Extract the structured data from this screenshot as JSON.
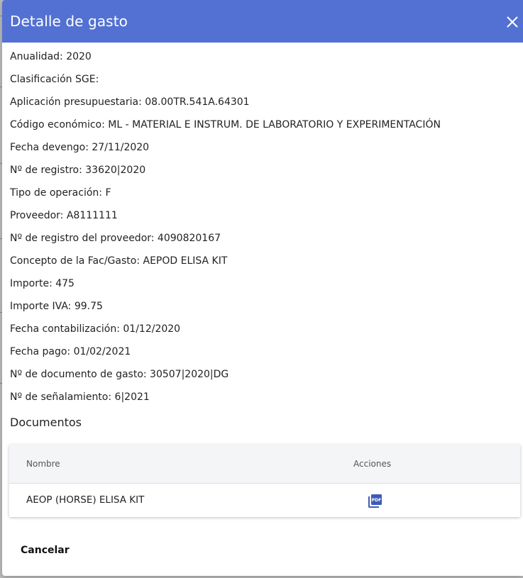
{
  "dialog": {
    "title": "Detalle de gasto"
  },
  "fields": [
    {
      "text": "Anualidad: 2020"
    },
    {
      "text": "Clasificación SGE:"
    },
    {
      "text": "Aplicación presupuestaria: 08.00TR.541A.64301"
    },
    {
      "text": "Código económico: ML - MATERIAL E INSTRUM. DE LABORATORIO Y EXPERIMENTACIÓN"
    },
    {
      "text": "Fecha devengo: 27/11/2020"
    },
    {
      "text": "Nº de registro: 33620|2020"
    },
    {
      "text": "Tipo de operación: F"
    },
    {
      "text": "Proveedor: A8111111"
    },
    {
      "text": "Nº de registro del proveedor: 4090820167"
    },
    {
      "text": "Concepto de la Fac/Gasto: AEPOD ELISA KIT"
    },
    {
      "text": "Importe: 475"
    },
    {
      "text": "Importe IVA: 99.75"
    },
    {
      "text": "Fecha contabilización: 01/12/2020"
    },
    {
      "text": "Fecha pago: 01/02/2021"
    },
    {
      "text": "Nº de documento de gasto: 30507|2020|DG"
    },
    {
      "text": "Nº de señalamiento: 6|2021"
    }
  ],
  "documents": {
    "section_title": "Documentos",
    "columns": [
      "Nombre",
      "Acciones"
    ],
    "rows": [
      {
        "name": "AEOP (HORSE) ELISA KIT",
        "action_icon": "pdf-icon"
      }
    ]
  },
  "footer": {
    "cancel_label": "Cancelar"
  },
  "colors": {
    "header_bg": "#5371d2",
    "pdf_icon": "#3f5bb8"
  }
}
